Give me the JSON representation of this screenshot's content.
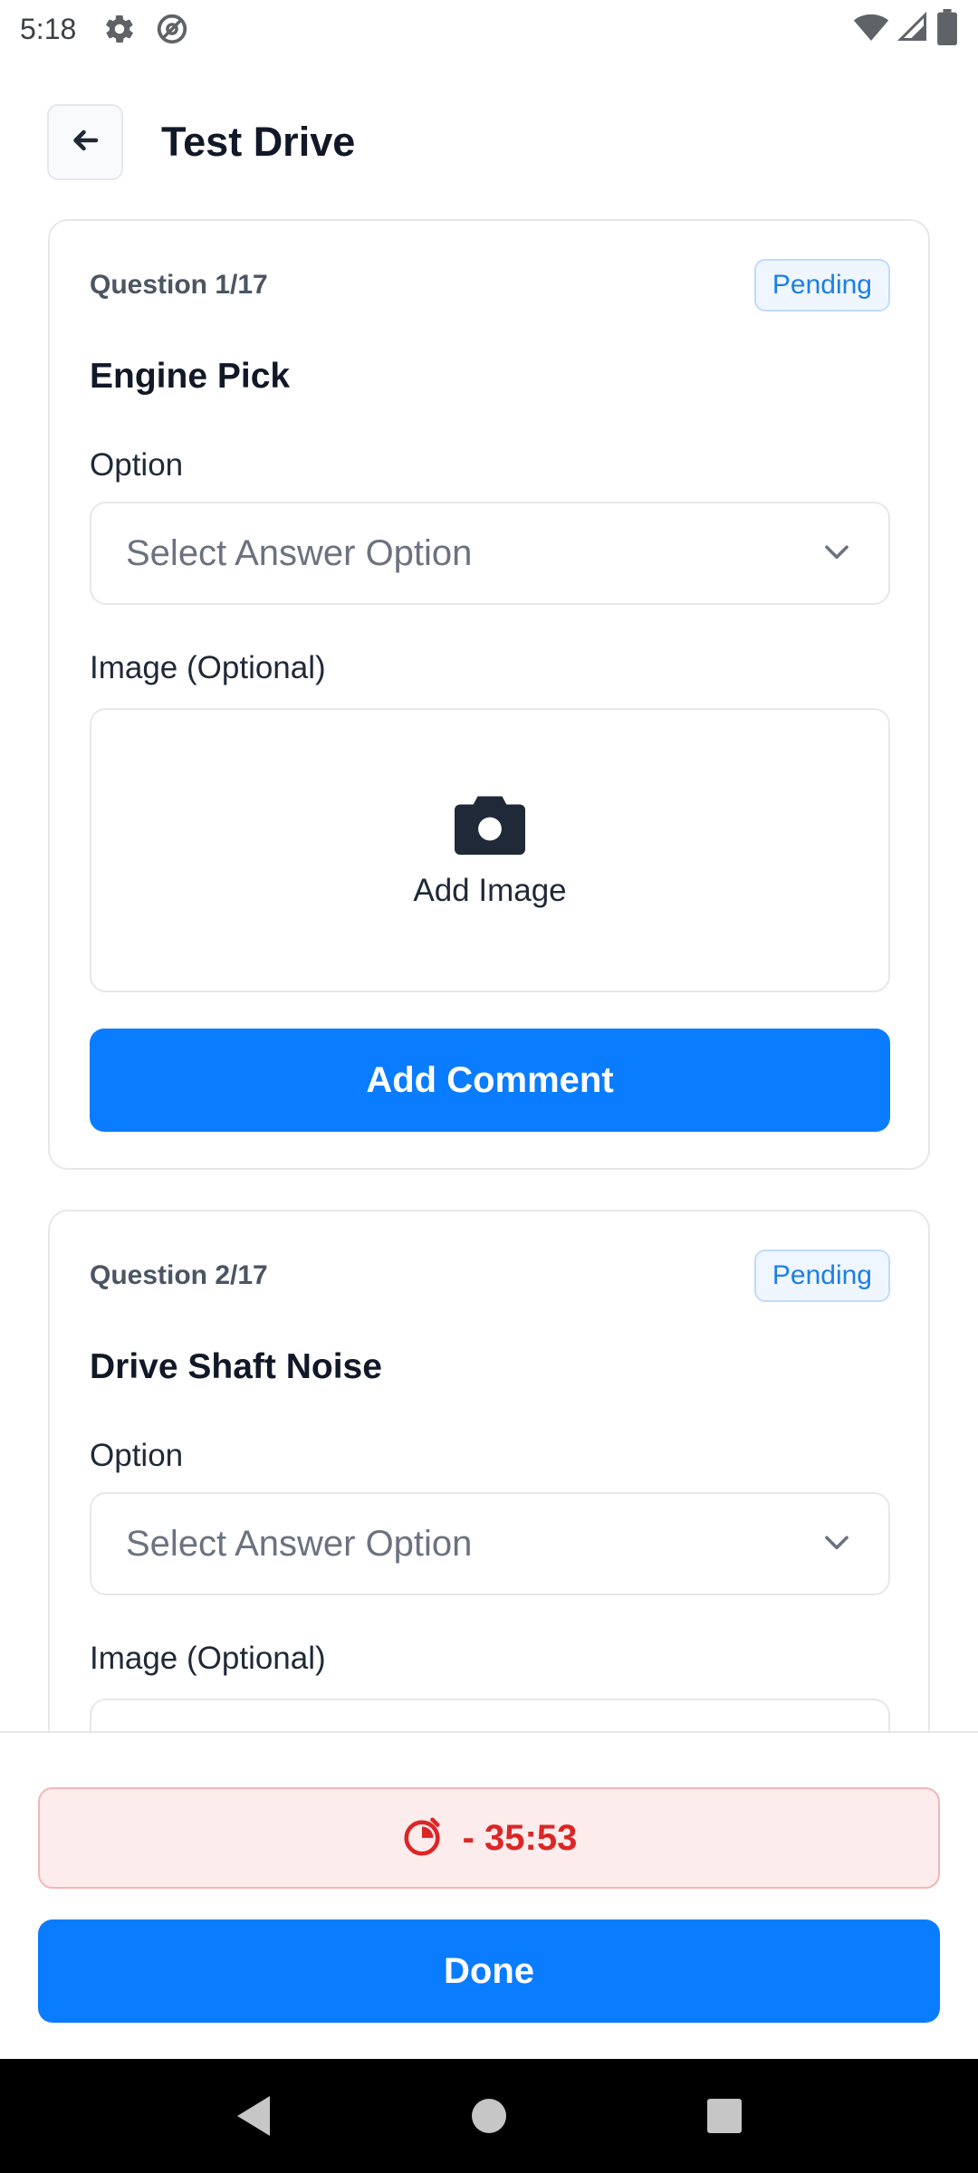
{
  "status_bar": {
    "time": "5:18",
    "icons": [
      "gear-icon",
      "at-sign-icon",
      "wifi-icon",
      "signal-icon",
      "battery-icon"
    ]
  },
  "header": {
    "title": "Test Drive",
    "back_icon": "arrow-left-icon"
  },
  "questions": [
    {
      "number": "Question 1/17",
      "status": "Pending",
      "title": "Engine Pick",
      "option_label": "Option",
      "select_placeholder": "Select Answer Option",
      "image_label": "Image (Optional)",
      "add_image_label": "Add Image",
      "comment_button": "Add Comment"
    },
    {
      "number": "Question 2/17",
      "status": "Pending",
      "title": "Drive Shaft Noise",
      "option_label": "Option",
      "select_placeholder": "Select Answer Option",
      "image_label": "Image (Optional)"
    }
  ],
  "footer": {
    "timer": "- 35:53",
    "done_label": "Done"
  },
  "colors": {
    "primary": "#0a7cff",
    "pending_text": "#1d7fe3",
    "timer_text": "#dc2626",
    "timer_bg": "#fdecec"
  }
}
